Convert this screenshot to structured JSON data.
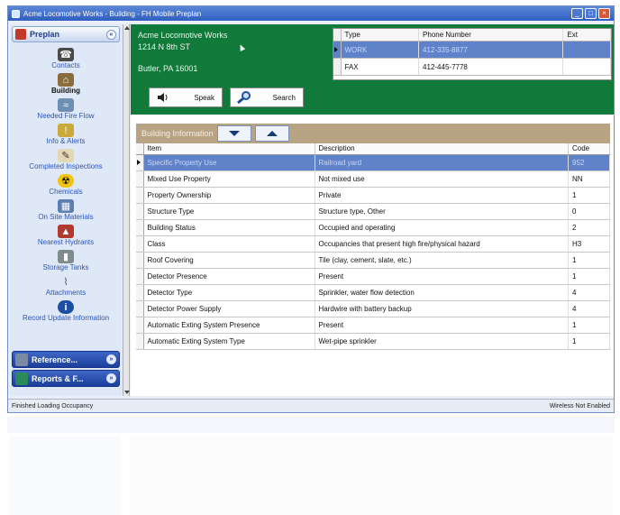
{
  "window": {
    "title": "Acme Locomotive Works - Building - FH Mobile Preplan",
    "controls": [
      "_",
      "□",
      "×"
    ]
  },
  "sidebar": {
    "group_label": "Preplan",
    "items": [
      {
        "label": "Contacts",
        "icon": "contacts-icon",
        "active": false
      },
      {
        "label": "Building",
        "icon": "building-icon",
        "active": true
      },
      {
        "label": "Needed Fire Flow",
        "icon": "fire-flow-icon",
        "active": false
      },
      {
        "label": "Info & Alerts",
        "icon": "alert-icon",
        "active": false
      },
      {
        "label": "Completed Inspections",
        "icon": "inspection-icon",
        "active": false
      },
      {
        "label": "Chemicals",
        "icon": "hazard-icon",
        "active": false
      },
      {
        "label": "On Site Materials",
        "icon": "materials-icon",
        "active": false
      },
      {
        "label": "Nearest Hydrants",
        "icon": "hydrant-icon",
        "active": false
      },
      {
        "label": "Storage Tanks",
        "icon": "tank-icon",
        "active": false
      },
      {
        "label": "Attachments",
        "icon": "paperclip-icon",
        "active": false
      },
      {
        "label": "Record Update Information",
        "icon": "info-icon",
        "active": false
      }
    ],
    "bottom_groups": [
      {
        "label": "Reference...",
        "icon": "reference-icon"
      },
      {
        "label": "Reports & F...",
        "icon": "reports-icon"
      }
    ]
  },
  "address": {
    "name": "Acme Locomotive Works",
    "street": "1214 N 8th ST",
    "city": "Butler, PA 16001"
  },
  "phone_table": {
    "columns": [
      "Type",
      "Phone Number",
      "Ext"
    ],
    "rows": [
      {
        "type": "WORK",
        "number": "412-335-8877",
        "ext": "",
        "selected": true
      },
      {
        "type": "FAX",
        "number": "412-445-7778",
        "ext": "",
        "selected": false
      }
    ]
  },
  "buttons": {
    "speak": "Speak",
    "search": "Search"
  },
  "building_info": {
    "title": "Building Information",
    "columns": [
      "Item",
      "Description",
      "Code"
    ],
    "rows": [
      {
        "item": "Specific Property Use",
        "description": "Railroad yard",
        "code": "952",
        "selected": true
      },
      {
        "item": "Mixed Use Property",
        "description": "Not mixed use",
        "code": "NN",
        "selected": false
      },
      {
        "item": "Property Ownership",
        "description": "Private",
        "code": "1",
        "selected": false
      },
      {
        "item": "Structure Type",
        "description": "Structure type, Other",
        "code": "0",
        "selected": false
      },
      {
        "item": "Building Status",
        "description": "Occupied and operating",
        "code": "2",
        "selected": false
      },
      {
        "item": "Class",
        "description": "Occupancies that present high fire/physical hazard",
        "code": "H3",
        "selected": false
      },
      {
        "item": "Roof Covering",
        "description": "Tile (clay, cement, slate, etc.)",
        "code": "1",
        "selected": false
      },
      {
        "item": "Detector Presence",
        "description": "Present",
        "code": "1",
        "selected": false
      },
      {
        "item": "Detector Type",
        "description": "Sprinkler, water flow detection",
        "code": "4",
        "selected": false
      },
      {
        "item": "Detector Power Supply",
        "description": "Hardwire with battery backup",
        "code": "4",
        "selected": false
      },
      {
        "item": "Automatic Exting System Presence",
        "description": "Present",
        "code": "1",
        "selected": false
      },
      {
        "item": "Automatic Exting System Type",
        "description": "Wet-pipe sprinkler",
        "code": "1",
        "selected": false
      }
    ]
  },
  "status": {
    "left": "Finished Loading Occupancy",
    "right": "Wireless Not Enabled"
  },
  "colors": {
    "green_panel": "#0f7a3a",
    "selection": "#5f82c8",
    "header_tan": "#b8a484",
    "nav_text": "#2f55b8"
  }
}
